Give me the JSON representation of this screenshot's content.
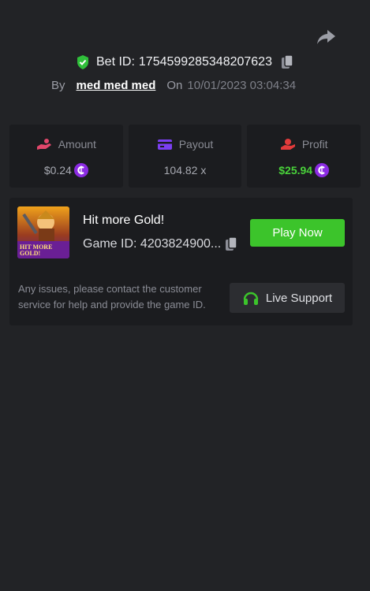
{
  "bet": {
    "id_label": "Bet ID:",
    "id_value": "1754599285348207623",
    "by_label": "By",
    "username": "med med med",
    "on_label": "On",
    "timestamp": "10/01/2023 03:04:34"
  },
  "stats": {
    "amount": {
      "label": "Amount",
      "value": "$0.24"
    },
    "payout": {
      "label": "Payout",
      "value": "104.82 x"
    },
    "profit": {
      "label": "Profit",
      "value": "$25.94"
    }
  },
  "game": {
    "title": "Hit more Gold!",
    "id_label": "Game ID:",
    "id_value": "4203824900...",
    "play_label": "Play Now",
    "thumbnail_text_line1": "HIT MORE",
    "thumbnail_text_line2": "GOLD!",
    "support_text": "Any issues, please contact the customer service for help and provide the game ID.",
    "support_label": "Live Support"
  },
  "icons": {
    "share": "share-arrow-icon",
    "verified": "shield-check-icon",
    "copy": "copy-icon",
    "amount": "hand-coins-icon",
    "payout": "card-icon",
    "profit": "hand-money-icon",
    "coin": "coin-icon",
    "support": "headset-icon"
  },
  "colors": {
    "background": "#222326",
    "card": "#1b1c1f",
    "accent_green": "#3cc42b",
    "profit_green": "#49d23a",
    "coin_purple": "#8b2be2",
    "amount_pink": "#e2476b",
    "payout_purple": "#7b3ff2",
    "profit_red": "#e23b3b"
  }
}
